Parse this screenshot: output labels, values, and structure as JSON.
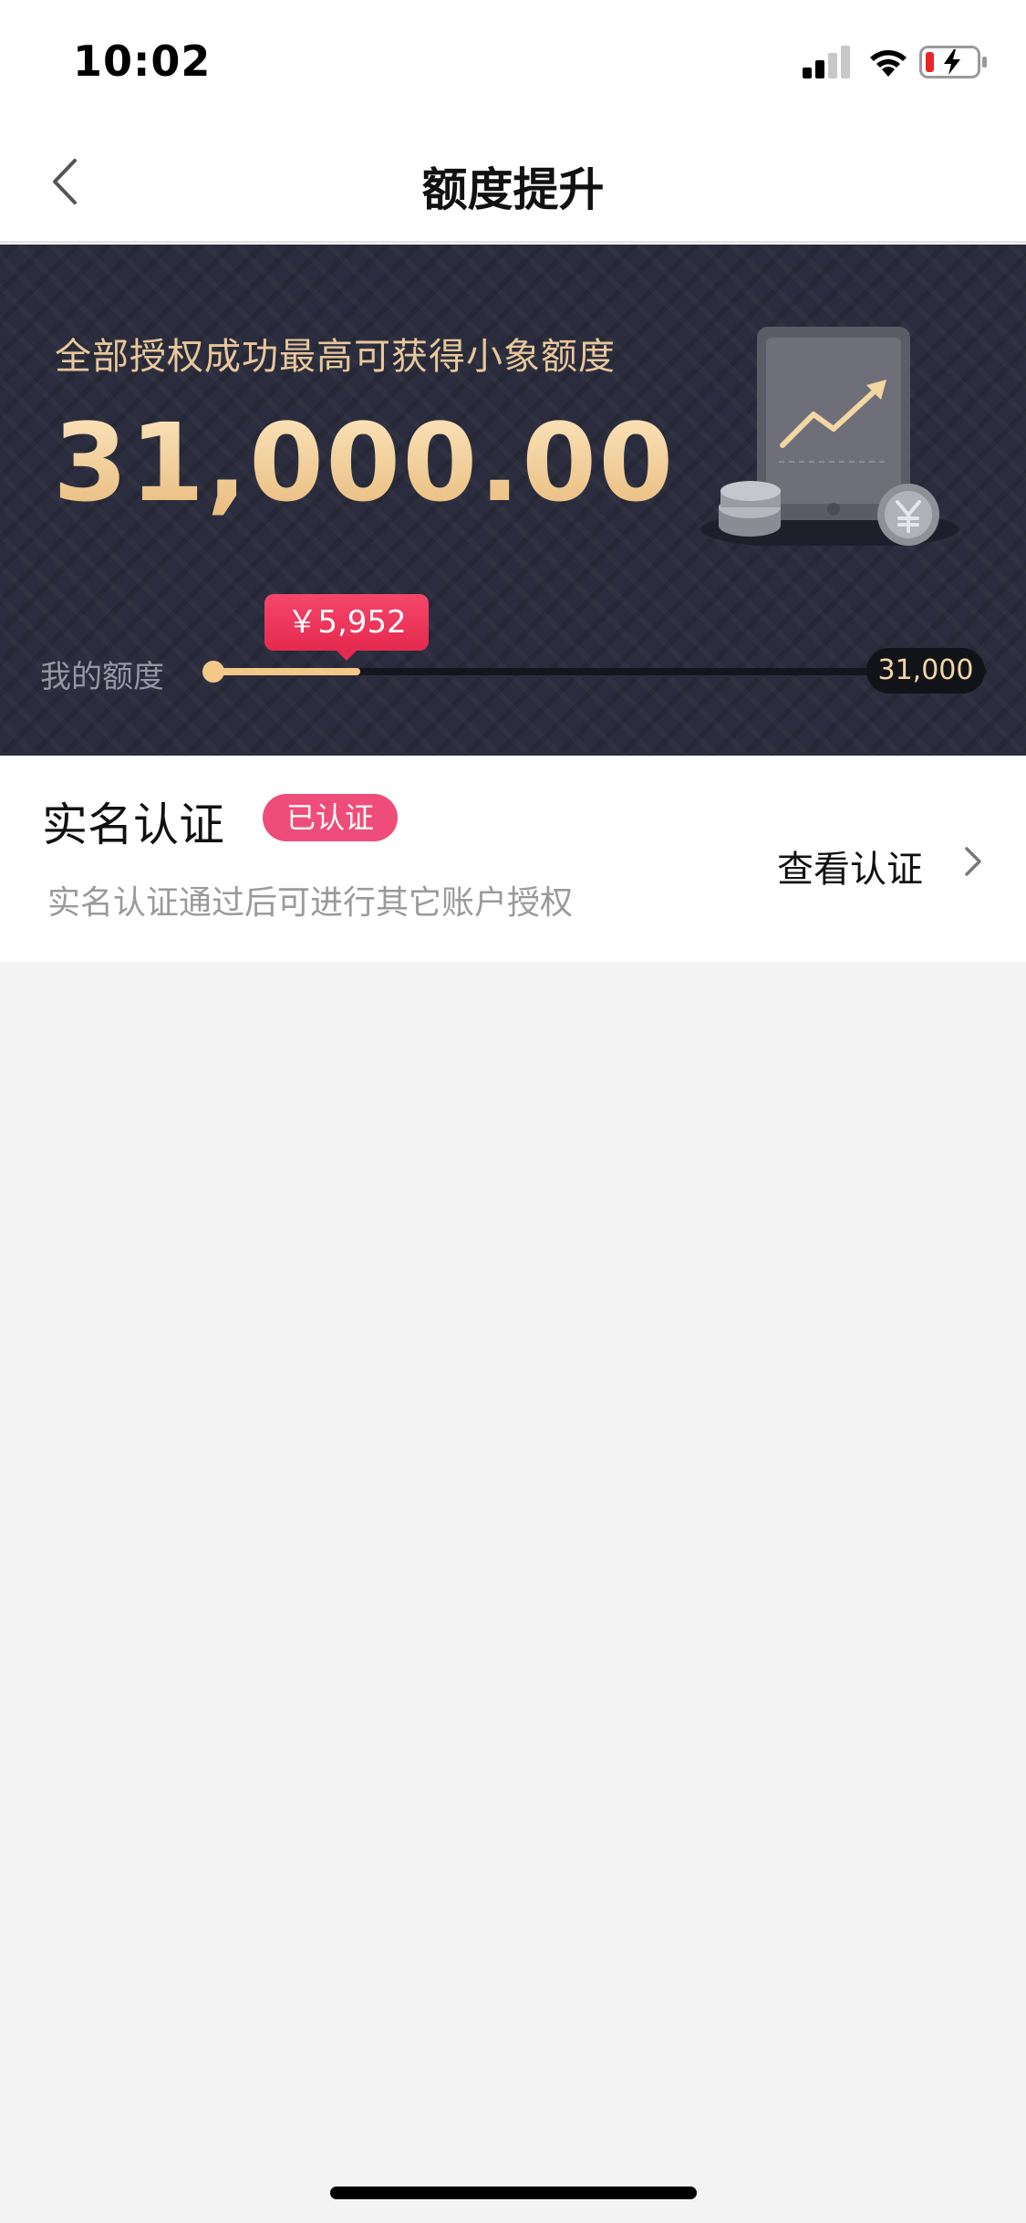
{
  "status_bar": {
    "time": "10:02",
    "icons": [
      "cellular-signal-icon",
      "wifi-icon",
      "battery-charging-icon"
    ]
  },
  "nav": {
    "title": "额度提升",
    "back_icon": "chevron-left-icon"
  },
  "hero": {
    "subtitle": "全部授权成功最高可获得小象额度",
    "amount": "31,000.00",
    "illustration": "tablet-chart-coins-illustration",
    "quota_label": "我的额度",
    "current_value": "￥5,952",
    "max_value": "31,000",
    "progress_fraction": 0.192
  },
  "verification": {
    "title": "实名认证",
    "badge": "已认证",
    "description": "实名认证通过后可进行其它账户授权",
    "link_label": "查看认证",
    "link_icon": "chevron-right-icon"
  },
  "colors": {
    "hero_bg": "#2b2d3e",
    "gold": "#f3c889",
    "badge_pink": "#ef4d79",
    "bubble_red": "#e5294f",
    "page_bg": "#f3f3f3"
  }
}
